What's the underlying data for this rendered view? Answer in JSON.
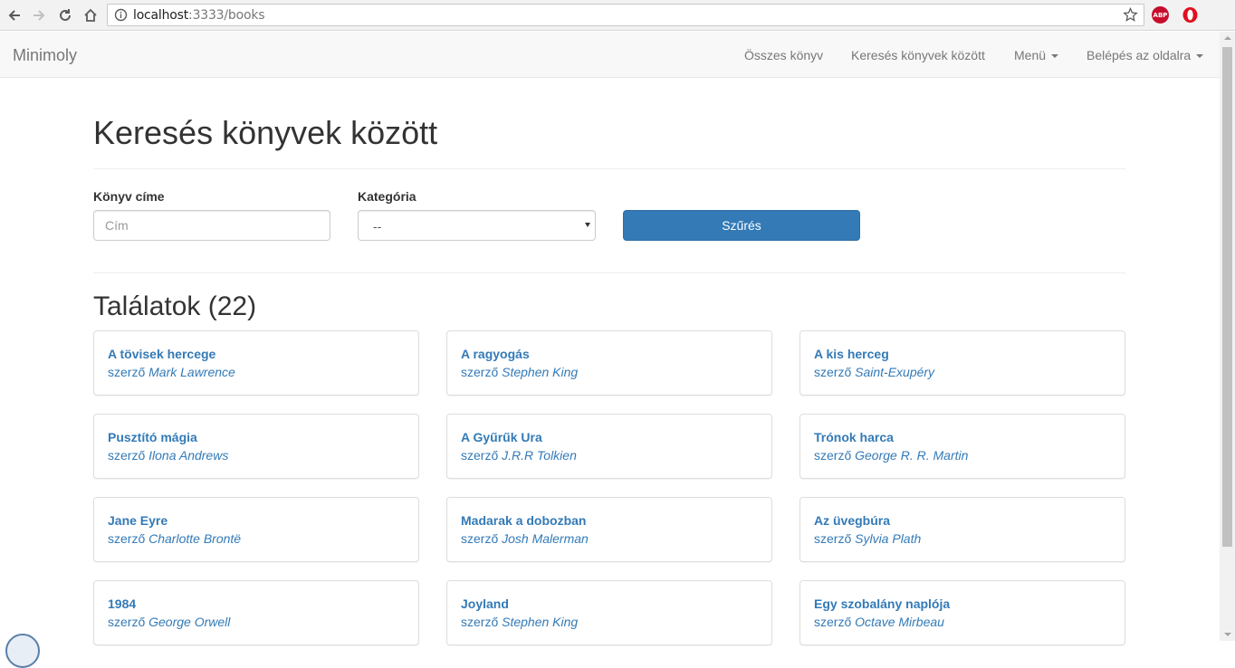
{
  "browser": {
    "url_host": "localhost",
    "url_rest": ":3333/books",
    "abp_label": "ABP"
  },
  "navbar": {
    "brand": "Minimoly",
    "links": [
      "Összes könyv",
      "Keresés könyvek között",
      "Menü",
      "Belépés az oldalra"
    ]
  },
  "page": {
    "title": "Keresés könyvek között",
    "filter": {
      "title_label": "Könyv címe",
      "title_placeholder": "Cím",
      "category_label": "Kategória",
      "category_value": "--",
      "submit_label": "Szűrés"
    },
    "results_title": "Találatok (22)",
    "author_prefix": "szerző",
    "books": [
      {
        "title": "A tövisek hercege",
        "author": "Mark Lawrence"
      },
      {
        "title": "A ragyogás",
        "author": "Stephen King"
      },
      {
        "title": "A kis herceg",
        "author": "Saint-Exupéry"
      },
      {
        "title": "Pusztító mágia",
        "author": "Ilona Andrews"
      },
      {
        "title": "A Gyűrűk Ura",
        "author": "J.R.R Tolkien"
      },
      {
        "title": "Trónok harca",
        "author": "George R. R. Martin"
      },
      {
        "title": "Jane Eyre",
        "author": "Charlotte Brontë"
      },
      {
        "title": "Madarak a dobozban",
        "author": "Josh Malerman"
      },
      {
        "title": "Az üvegbúra",
        "author": "Sylvia Plath"
      },
      {
        "title": "1984",
        "author": "George Orwell"
      },
      {
        "title": "Joyland",
        "author": "Stephen King"
      },
      {
        "title": "Egy szobalány naplója",
        "author": "Octave Mirbeau"
      }
    ]
  },
  "colors": {
    "link": "#337ab7",
    "primary_button": "#337ab7",
    "navbar_bg": "#f8f8f8"
  }
}
